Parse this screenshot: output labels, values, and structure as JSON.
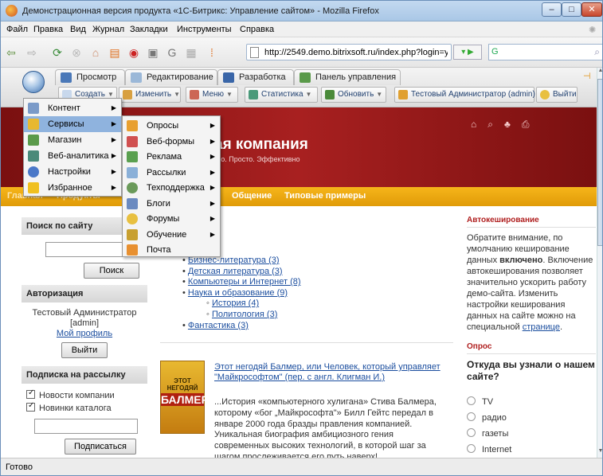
{
  "browser": {
    "title": "Демонстрационная версия продукта «1С-Битрикс: Управление сайтом» - Mozilla Firefox",
    "menu": [
      "Файл",
      "Правка",
      "Вид",
      "Журнал",
      "Закладки",
      "Инструменты",
      "Справка"
    ],
    "url": "http://2549.demo.bitrixsoft.ru/index.php?login=ye",
    "search_engine": "G",
    "status": "Готово"
  },
  "panel": {
    "tabs": [
      "Просмотр",
      "Редактирование",
      "Разработка",
      "Панель управления"
    ],
    "toolbar": {
      "create": "Создать",
      "edit": "Изменить",
      "menu": "Меню",
      "stats": "Статистика",
      "refresh": "Обновить",
      "user": "Тестовый Администратор (admin)",
      "logout": "Выйти"
    }
  },
  "menu1": [
    "Контент",
    "Сервисы",
    "Магазин",
    "Веб-аналитика",
    "Настройки",
    "Избранное"
  ],
  "menu2": [
    "Опросы",
    "Веб-формы",
    "Реклама",
    "Рассылки",
    "Техподдержка",
    "Блоги",
    "Форумы",
    "Обучение",
    "Почта"
  ],
  "site": {
    "company_title": "ая компания",
    "slogan": "гро. Просто. Эффективно",
    "nav_hidden_1": "Главная",
    "nav_hidden_2": "Продукты",
    "nav": [
      "Общение",
      "Типовые примеры"
    ]
  },
  "sidebar": {
    "search_title": "Поиск по сайту",
    "search_btn": "Поиск",
    "auth_title": "Авторизация",
    "user_name": "Тестовый Администратор",
    "user_login": "[admin]",
    "profile_link": "Мой профиль",
    "logout_btn": "Выйти",
    "subscribe_title": "Подписка на рассылку",
    "sub1": "Новости компании",
    "sub2": "Новинки каталога",
    "subscribe_btn": "Подписаться"
  },
  "main": {
    "catalog_tail": "иг",
    "categories": [
      {
        "label": "Бизнес-литература (3)",
        "level": 1
      },
      {
        "label": "Детская литература (3)",
        "level": 1
      },
      {
        "label": "Компьютеры и Интернет (8)",
        "level": 1
      },
      {
        "label": "Наука и образование (9)",
        "level": 1
      },
      {
        "label": "История (4)",
        "level": 2
      },
      {
        "label": "Политология (3)",
        "level": 2
      },
      {
        "label": "Фантастика (3)",
        "level": 1
      }
    ],
    "book_title": "Этот негодяй Балмер, или Человек, который управляет \"Майкрософтом\" (пер. с англ. Клигман И.)",
    "book_cover_small": "ЭТОТ НЕГОДЯЙ",
    "book_cover_big": "БАЛМЕР",
    "book_text": "...История «компьютерного хулигана» Стива Балмера, которому «бог „Майкрософта\"» Билл Гейтс передал в январе 2000 года бразды правления компанией. Уникальная биография амбициозного гения современных высоких технологий, в которой шаг за шагом прослеживается его путь наверх!"
  },
  "right": {
    "cache_title": "Автокеширование",
    "cache_text_1": "Обратите внимание, по умолчанию кеширование данных",
    "cache_bold": "включено",
    "cache_text_2": ". Включение автокеширования позволяет значительно ускорить работу демо-сайта. Изменить настройки кеширования данных на сайте можно на специальной",
    "cache_link": "странице",
    "poll_title": "Опрос",
    "poll_question": "Откуда вы узнали о нашем сайте?",
    "poll_options": [
      "TV",
      "радио",
      "газеты",
      "Internet"
    ]
  }
}
